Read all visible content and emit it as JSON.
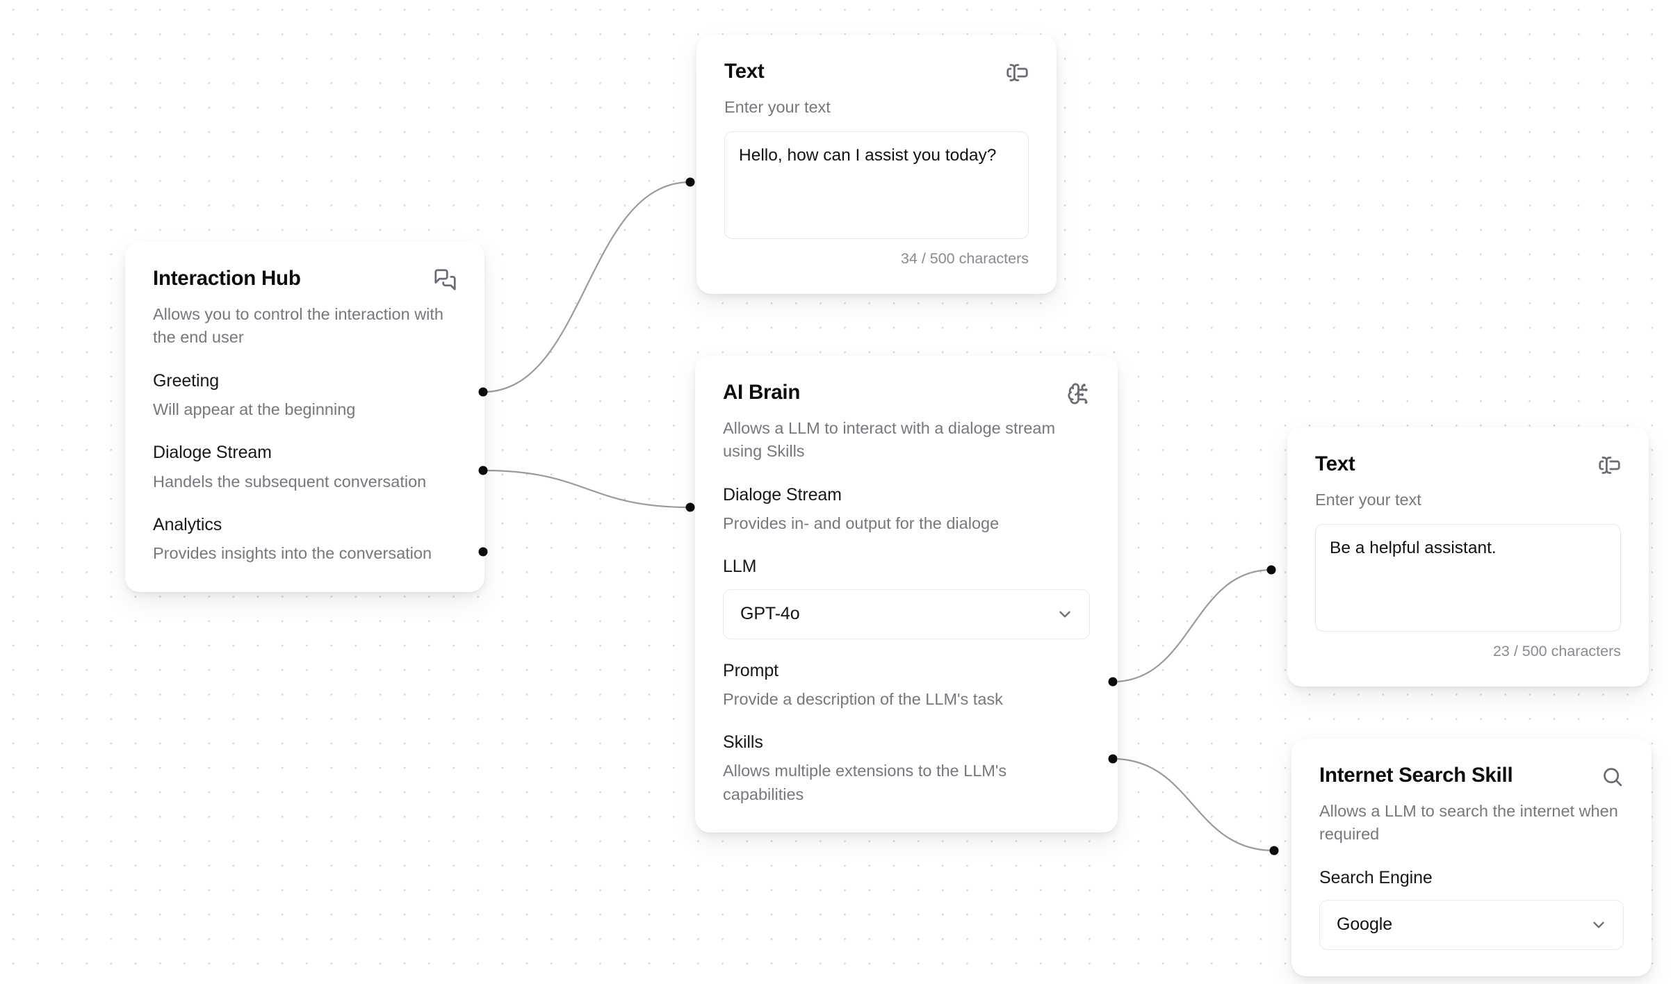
{
  "canvas": {
    "background_color": "#ffffff",
    "dot_color": "#d4d4d8",
    "edge_color": "#9a9a9e",
    "handle_color": "#0a0a0a"
  },
  "nodes": {
    "interaction_hub": {
      "title": "Interaction Hub",
      "icon": "messages-square-icon",
      "description": "Allows you to control the interaction with the end user",
      "fields": [
        {
          "label": "Greeting",
          "sub": "Will appear at the beginning"
        },
        {
          "label": "Dialoge Stream",
          "sub": "Handels the subsequent conversation"
        },
        {
          "label": "Analytics",
          "sub": "Provides insights into the conversation"
        }
      ]
    },
    "text_greeting": {
      "title": "Text",
      "icon": "text-cursor-input-icon",
      "description": "Enter your text",
      "value": "Hello, how can I assist you today?",
      "placeholder": "Enter your text",
      "char_count": "34 / 500 characters"
    },
    "ai_brain": {
      "title": "AI Brain",
      "icon": "brain-circuit-icon",
      "description": "Allows a LLM to interact with a dialoge stream using Skills",
      "fields": [
        {
          "label": "Dialoge Stream",
          "sub": "Provides in- and output for the dialoge"
        },
        {
          "label": "Prompt",
          "sub": "Provide a description of the LLM's task"
        },
        {
          "label": "Skills",
          "sub": "Allows multiple extensions to the LLM's capabilities"
        }
      ],
      "llm": {
        "label": "LLM",
        "value": "GPT-4o",
        "chevron": "chevron-down-icon"
      }
    },
    "text_prompt": {
      "title": "Text",
      "icon": "text-cursor-input-icon",
      "description": "Enter your text",
      "value": "Be a helpful assistant.",
      "placeholder": "Enter your text",
      "char_count": "23 / 500 characters"
    },
    "search_skill": {
      "title": "Internet Search Skill",
      "icon": "search-icon",
      "description": "Allows a LLM to search the internet when required",
      "search_engine": {
        "label": "Search Engine",
        "value": "Google",
        "chevron": "chevron-down-icon"
      }
    }
  }
}
